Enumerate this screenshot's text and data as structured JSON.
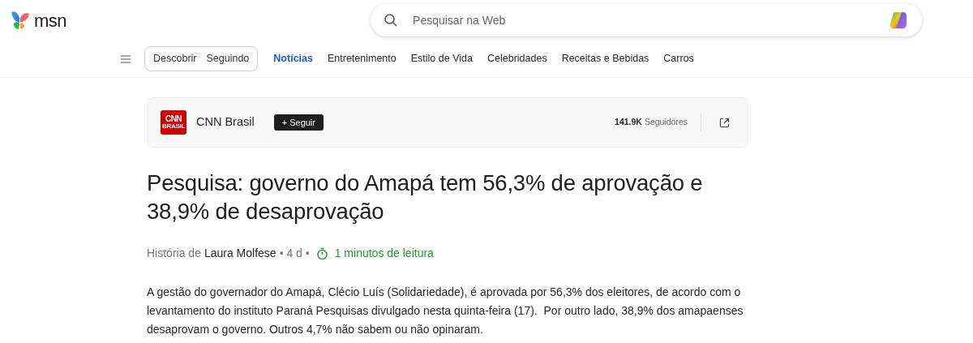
{
  "header": {
    "logo_text": "msn",
    "search": {
      "placeholder": "Pesquisar na Web"
    }
  },
  "feed_tabs": [
    {
      "label": "Descobrir",
      "selected": false
    },
    {
      "label": "Seguindo",
      "selected": false
    }
  ],
  "categories": [
    {
      "label": "Notícias",
      "selected": true
    },
    {
      "label": "Entretenimento",
      "selected": false
    },
    {
      "label": "Estilo de Vida",
      "selected": false
    },
    {
      "label": "Celebridades",
      "selected": false
    },
    {
      "label": "Receitas e Bebidas",
      "selected": false
    },
    {
      "label": "Carros",
      "selected": false
    }
  ],
  "publisher": {
    "logo_text": "CNN",
    "logo_subtext": "BRASIL",
    "name": "CNN Brasil",
    "follow_button": "+ Seguir",
    "followers_count": "141.9K",
    "followers_label": "Seguidores"
  },
  "article": {
    "title": "Pesquisa: governo do Amapá tem 56,3% de aprovação e 38,9% de desaprovação",
    "byline_prefix": "História de",
    "author": "Laura Molfese",
    "age": "• 4 d •",
    "read_time": "1 minutos de leitura",
    "body": "A gestão do governador do Amapá, Clécio Luís (Solidariedade), é aprovada por 56,3% dos eleitores, de acordo com o levantamento do instituto Paraná Pesquisas divulgado nesta quinta-feira (17).  Por outro lado, 38,9% dos amapaenses desaprovam o governo. Outros 4,7% não sabem ou não opinaram."
  }
}
